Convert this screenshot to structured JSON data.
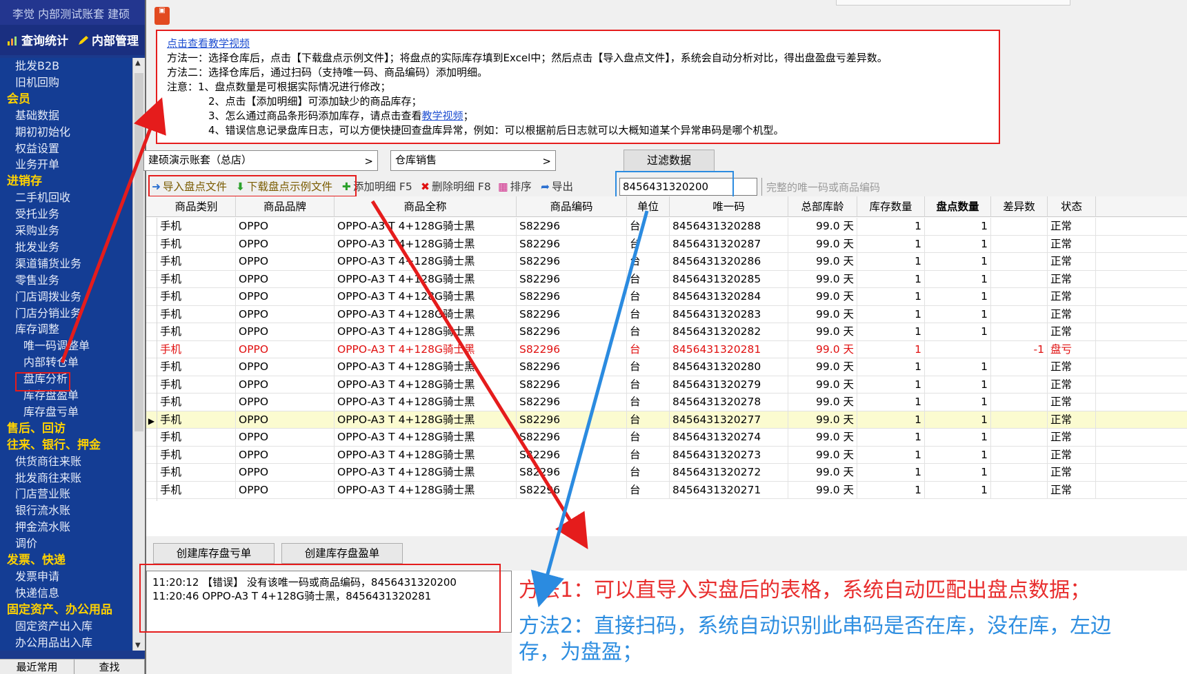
{
  "sidebar": {
    "user_line": "李觉  内部测试账套  建硕",
    "tabs": [
      "查询统计",
      "内部管理"
    ],
    "items": [
      {
        "label": "批发B2B",
        "type": "lvl1"
      },
      {
        "label": "旧机回购",
        "type": "lvl1"
      },
      {
        "label": "会员",
        "type": "sect"
      },
      {
        "label": "基础数据",
        "type": "lvl1"
      },
      {
        "label": "期初初始化",
        "type": "lvl1"
      },
      {
        "label": "权益设置",
        "type": "lvl1"
      },
      {
        "label": "业务开单",
        "type": "lvl1"
      },
      {
        "label": "进销存",
        "type": "sect"
      },
      {
        "label": "二手机回收",
        "type": "lvl1"
      },
      {
        "label": "受托业务",
        "type": "lvl1"
      },
      {
        "label": "采购业务",
        "type": "lvl1"
      },
      {
        "label": "批发业务",
        "type": "lvl1"
      },
      {
        "label": "渠道铺货业务",
        "type": "lvl1"
      },
      {
        "label": "零售业务",
        "type": "lvl1"
      },
      {
        "label": "门店调拨业务",
        "type": "lvl1"
      },
      {
        "label": "门店分销业务",
        "type": "lvl1"
      },
      {
        "label": "库存调整",
        "type": "lvl1"
      },
      {
        "label": "唯一码调整单",
        "type": "lvl2"
      },
      {
        "label": "内部转仓单",
        "type": "lvl2"
      },
      {
        "label": "盘库分析",
        "type": "lvl2"
      },
      {
        "label": "库存盘盈单",
        "type": "lvl2"
      },
      {
        "label": "库存盘亏单",
        "type": "lvl2"
      },
      {
        "label": "售后、回访",
        "type": "sect"
      },
      {
        "label": "往来、银行、押金",
        "type": "sect"
      },
      {
        "label": "供货商往来账",
        "type": "lvl1"
      },
      {
        "label": "批发商往来账",
        "type": "lvl1"
      },
      {
        "label": "门店营业账",
        "type": "lvl1"
      },
      {
        "label": "银行流水账",
        "type": "lvl1"
      },
      {
        "label": "押金流水账",
        "type": "lvl1"
      },
      {
        "label": "调价",
        "type": "lvl1"
      },
      {
        "label": "发票、快递",
        "type": "sect"
      },
      {
        "label": "发票申请",
        "type": "lvl1"
      },
      {
        "label": "快递信息",
        "type": "lvl1"
      },
      {
        "label": "固定资产、办公用品",
        "type": "sect"
      },
      {
        "label": "固定资产出入库",
        "type": "lvl1"
      },
      {
        "label": "办公用品出入库",
        "type": "lvl1"
      }
    ],
    "bottom_buttons": [
      "最近常用",
      "查找"
    ]
  },
  "notice": {
    "video_link": "点击查看教学视频",
    "line1": "方法一：选择仓库后，点击【下载盘点示例文件】；将盘点的实际库存填到Excel中；然后点击【导入盘点文件】，系统会自动分析对比，得出盘盈盘亏差异数。",
    "line2": "方法二：选择仓库后，通过扫码（支持唯一码、商品编码）添加明细。",
    "line3": "注意：1、盘点数量是可根据实际情况进行修改；",
    "line4": "2、点击【添加明细】可添加缺少的商品库存；",
    "line5_pre": "3、怎么通过商品条形码添加库存，请点击查看",
    "line5_link": "教学视频",
    "line5_post": "；",
    "line6": "4、错误信息记录盘库日志，可以方便快捷回查盘库异常，例如：可以根据前后日志就可以大概知道某个异常串码是哪个机型。"
  },
  "filters": {
    "account_set": "建硕演示账套（总店）",
    "warehouse": "仓库销售",
    "filter_button": "过滤数据"
  },
  "toolbar": {
    "import": "导入盘点文件",
    "download": "下载盘点示例文件",
    "add": "添加明细 F5",
    "delete": "删除明细 F8",
    "sort": "排序",
    "export": "导出",
    "scan_value": "8456431320200",
    "scan_hint": "完整的唯一码或商品编码"
  },
  "grid": {
    "headers": [
      "商品类别",
      "商品品牌",
      "商品全称",
      "商品编码",
      "单位",
      "唯一码",
      "总部库龄",
      "库存数量",
      "盘点数量",
      "差异数",
      "状态"
    ],
    "rows": [
      {
        "cat": "手机",
        "brand": "OPPO",
        "name": "OPPO-A3 T 4+128G骑士黑",
        "code": "S82296",
        "unit": "台",
        "imei": "8456431320288",
        "age": "99.0 天",
        "stock": "1",
        "count": "1",
        "diff": "",
        "status": "正常"
      },
      {
        "cat": "手机",
        "brand": "OPPO",
        "name": "OPPO-A3 T 4+128G骑士黑",
        "code": "S82296",
        "unit": "台",
        "imei": "8456431320287",
        "age": "99.0 天",
        "stock": "1",
        "count": "1",
        "diff": "",
        "status": "正常"
      },
      {
        "cat": "手机",
        "brand": "OPPO",
        "name": "OPPO-A3 T 4+128G骑士黑",
        "code": "S82296",
        "unit": "台",
        "imei": "8456431320286",
        "age": "99.0 天",
        "stock": "1",
        "count": "1",
        "diff": "",
        "status": "正常"
      },
      {
        "cat": "手机",
        "brand": "OPPO",
        "name": "OPPO-A3 T 4+128G骑士黑",
        "code": "S82296",
        "unit": "台",
        "imei": "8456431320285",
        "age": "99.0 天",
        "stock": "1",
        "count": "1",
        "diff": "",
        "status": "正常"
      },
      {
        "cat": "手机",
        "brand": "OPPO",
        "name": "OPPO-A3 T 4+128G骑士黑",
        "code": "S82296",
        "unit": "台",
        "imei": "8456431320284",
        "age": "99.0 天",
        "stock": "1",
        "count": "1",
        "diff": "",
        "status": "正常"
      },
      {
        "cat": "手机",
        "brand": "OPPO",
        "name": "OPPO-A3 T 4+128G骑士黑",
        "code": "S82296",
        "unit": "台",
        "imei": "8456431320283",
        "age": "99.0 天",
        "stock": "1",
        "count": "1",
        "diff": "",
        "status": "正常"
      },
      {
        "cat": "手机",
        "brand": "OPPO",
        "name": "OPPO-A3 T 4+128G骑士黑",
        "code": "S82296",
        "unit": "台",
        "imei": "8456431320282",
        "age": "99.0 天",
        "stock": "1",
        "count": "1",
        "diff": "",
        "status": "正常"
      },
      {
        "cat": "手机",
        "brand": "OPPO",
        "name": "OPPO-A3 T 4+128G骑士黑",
        "code": "S82296",
        "unit": "台",
        "imei": "8456431320281",
        "age": "99.0 天",
        "stock": "1",
        "count": "",
        "diff": "-1",
        "status": "盘亏"
      },
      {
        "cat": "手机",
        "brand": "OPPO",
        "name": "OPPO-A3 T 4+128G骑士黑",
        "code": "S82296",
        "unit": "台",
        "imei": "8456431320280",
        "age": "99.0 天",
        "stock": "1",
        "count": "1",
        "diff": "",
        "status": "正常"
      },
      {
        "cat": "手机",
        "brand": "OPPO",
        "name": "OPPO-A3 T 4+128G骑士黑",
        "code": "S82296",
        "unit": "台",
        "imei": "8456431320279",
        "age": "99.0 天",
        "stock": "1",
        "count": "1",
        "diff": "",
        "status": "正常"
      },
      {
        "cat": "手机",
        "brand": "OPPO",
        "name": "OPPO-A3 T 4+128G骑士黑",
        "code": "S82296",
        "unit": "台",
        "imei": "8456431320278",
        "age": "99.0 天",
        "stock": "1",
        "count": "1",
        "diff": "",
        "status": "正常"
      },
      {
        "cat": "手机",
        "brand": "OPPO",
        "name": "OPPO-A3 T 4+128G骑士黑",
        "code": "S82296",
        "unit": "台",
        "imei": "8456431320277",
        "age": "99.0 天",
        "stock": "1",
        "count": "1",
        "diff": "",
        "status": "正常"
      },
      {
        "cat": "手机",
        "brand": "OPPO",
        "name": "OPPO-A3 T 4+128G骑士黑",
        "code": "S82296",
        "unit": "台",
        "imei": "8456431320274",
        "age": "99.0 天",
        "stock": "1",
        "count": "1",
        "diff": "",
        "status": "正常"
      },
      {
        "cat": "手机",
        "brand": "OPPO",
        "name": "OPPO-A3 T 4+128G骑士黑",
        "code": "S82296",
        "unit": "台",
        "imei": "8456431320273",
        "age": "99.0 天",
        "stock": "1",
        "count": "1",
        "diff": "",
        "status": "正常"
      },
      {
        "cat": "手机",
        "brand": "OPPO",
        "name": "OPPO-A3 T 4+128G骑士黑",
        "code": "S82296",
        "unit": "台",
        "imei": "8456431320272",
        "age": "99.0 天",
        "stock": "1",
        "count": "1",
        "diff": "",
        "status": "正常"
      },
      {
        "cat": "手机",
        "brand": "OPPO",
        "name": "OPPO-A3 T 4+128G骑士黑",
        "code": "S82296",
        "unit": "台",
        "imei": "8456431320271",
        "age": "99.0 天",
        "stock": "1",
        "count": "1",
        "diff": "",
        "status": "正常"
      }
    ]
  },
  "bottom": {
    "btn_loss": "创建库存盘亏单",
    "btn_gain": "创建库存盘盈单",
    "log": [
      "11:20:12 【错误】 没有该唯一码或商品编码，8456431320200",
      "11:20:46  OPPO-A3 T 4+128G骑士黑，8456431320281"
    ],
    "method1": "方法1：可以直导入实盘后的表格，系统自动匹配出盘点数据；",
    "method2_l1": "方法2：直接扫码，系统自动识别此串码是否在库，没在库，左边",
    "method2_l2": "存，为盘盈；"
  },
  "colors": {
    "annotation_red": "#e51c1c",
    "annotation_blue": "#2b8be0",
    "sidebar_bg": "#143d94",
    "section_yellow": "#ffd200"
  }
}
